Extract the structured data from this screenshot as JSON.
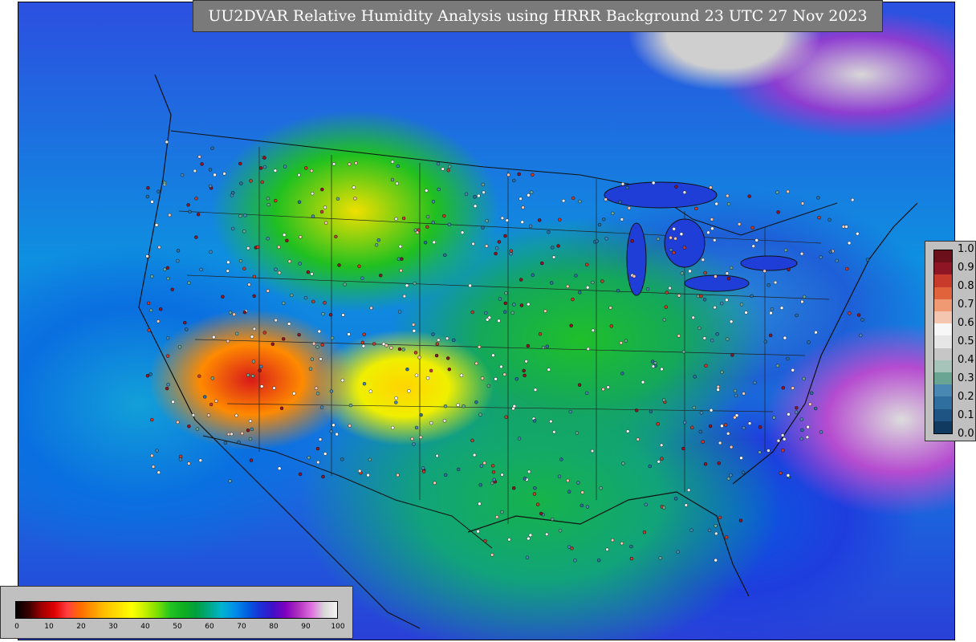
{
  "header": {
    "title": "UU2DVAR Relative Humidity Analysis using HRRR Background 23 UTC 27 Nov 2023"
  },
  "legend_observations": {
    "ticks": [
      "1.0",
      "0.9",
      "0.8",
      "0.7",
      "0.6",
      "0.5",
      "0.4",
      "0.3",
      "0.2",
      "0.1",
      "0.0"
    ],
    "colors": [
      "#6b0f1a",
      "#8e1523",
      "#c83a2a",
      "#e1633c",
      "#ef9a73",
      "#f4c6b0",
      "#f7f7f7",
      "#e6e6e6",
      "#c6c6c6",
      "#a7c4bb",
      "#6aa594",
      "#4a88b4",
      "#2f6fa0",
      "#1d5484",
      "#103a60"
    ]
  },
  "legend_analysis": {
    "ticks": [
      "0",
      "10",
      "20",
      "30",
      "40",
      "50",
      "60",
      "70",
      "80",
      "90",
      "100"
    ],
    "colors": [
      "#000000",
      "#3a0000",
      "#a00000",
      "#e00000",
      "#ff4040",
      "#ff6a00",
      "#ff9a00",
      "#ffc400",
      "#ffe000",
      "#ffff00",
      "#c8f000",
      "#7ce000",
      "#22c422",
      "#10b020",
      "#00a03c",
      "#00a880",
      "#00b4d0",
      "#0090e8",
      "#0060e0",
      "#1a30d8",
      "#4010c8",
      "#8000c0",
      "#b030c0",
      "#e070e0",
      "#d8d8d8",
      "#f4f4f4"
    ]
  }
}
